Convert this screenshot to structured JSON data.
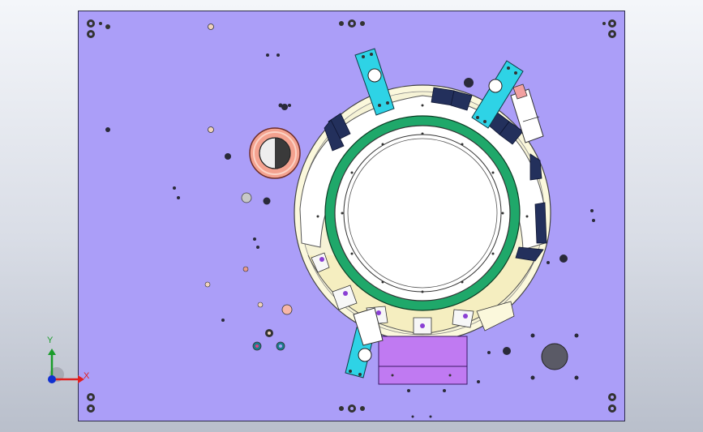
{
  "viewport": {
    "background_top": "#f4f6fa",
    "background_bottom": "#b9bfcb"
  },
  "model": {
    "plate_color": "#ab9ef8",
    "green_ring_color": "#1fa86a",
    "cyan_bracket_color": "#2ed3e6",
    "navy_clamp_color": "#23305c",
    "cream_color": "#fbf8dc",
    "purple_block_color": "#c07af2",
    "coil_color": "#f4a28f"
  },
  "triad": {
    "x_label": "X",
    "y_label": "Y",
    "x_color": "#e02020",
    "y_color": "#1a9c2a",
    "z_color": "#1030d0"
  }
}
